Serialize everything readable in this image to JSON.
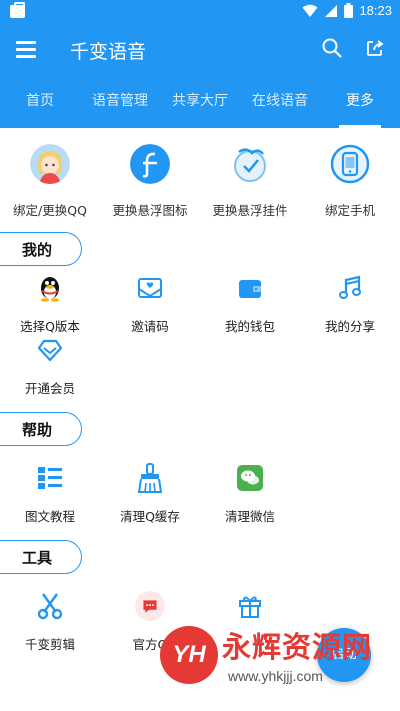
{
  "status": {
    "time": "18:23"
  },
  "appbar": {
    "title": "千变语音"
  },
  "tabs": [
    {
      "label": "首页"
    },
    {
      "label": "语音管理"
    },
    {
      "label": "共享大厅"
    },
    {
      "label": "在线语音"
    },
    {
      "label": "更多",
      "active": true
    }
  ],
  "top_items": [
    {
      "label": "绑定/更换QQ",
      "icon": "avatar-icon"
    },
    {
      "label": "更换悬浮图标",
      "icon": "float-icon-icon"
    },
    {
      "label": "更换悬浮挂件",
      "icon": "pendant-icon"
    },
    {
      "label": "绑定手机",
      "icon": "phone-icon"
    }
  ],
  "sections": {
    "mine": {
      "title": "我的",
      "items": [
        {
          "label": "选择Q版本",
          "icon": "qq-penguin-icon"
        },
        {
          "label": "邀请码",
          "icon": "envelope-heart-icon"
        },
        {
          "label": "我的钱包",
          "icon": "wallet-icon"
        },
        {
          "label": "我的分享",
          "icon": "music-note-icon"
        },
        {
          "label": "开通会员",
          "icon": "diamond-icon"
        }
      ]
    },
    "help": {
      "title": "帮助",
      "items": [
        {
          "label": "图文教程",
          "icon": "list-icon"
        },
        {
          "label": "清理Q缓存",
          "icon": "broom-icon"
        },
        {
          "label": "清理微信",
          "icon": "wechat-icon"
        }
      ]
    },
    "tools": {
      "title": "工具",
      "items": [
        {
          "label": "千变剪辑",
          "icon": "scissors-icon"
        },
        {
          "label": "官方Q",
          "icon": "chat-bubble-icon"
        },
        {
          "label": "",
          "icon": "gift-icon"
        }
      ]
    }
  },
  "fab": {
    "label": "启动"
  },
  "watermark": {
    "logo": "YH",
    "text": "永辉资源网",
    "url": "www.yhkjjj.com"
  },
  "colors": {
    "primary": "#2196F3",
    "watermark": "#e53935"
  }
}
